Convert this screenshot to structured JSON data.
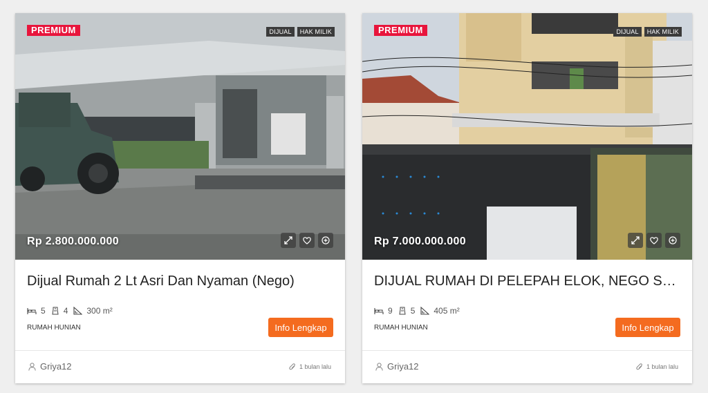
{
  "listings": [
    {
      "badge": "PREMIUM",
      "tags": [
        "DIJUAL",
        "HAK MILIK"
      ],
      "price": "Rp 2.800.000.000",
      "title": "Dijual Rumah 2 Lt Asri Dan Nyaman (Nego)",
      "bedrooms": "5",
      "bathrooms": "4",
      "area": "300 m²",
      "property_type": "RUMAH HUNIAN",
      "cta": "Info Lengkap",
      "agent": "Griya12",
      "posted": "1 bulan lalu"
    },
    {
      "badge": "PREMIUM",
      "tags": [
        "DIJUAL",
        "HAK MILIK"
      ],
      "price": "Rp 7.000.000.000",
      "title": "DIJUAL RUMAH DI PELEPAH ELOK, NEGO SAMPAI JADI",
      "bedrooms": "9",
      "bathrooms": "5",
      "area": "405 m²",
      "property_type": "RUMAH HUNIAN",
      "cta": "Info Lengkap",
      "agent": "Griya12",
      "posted": "1 bulan lalu"
    }
  ],
  "colors": {
    "premium": "#e8153c",
    "cta": "#f46b1f",
    "tag": "#3b3b3b"
  },
  "icons": [
    "expand-icon",
    "heart-icon",
    "plus-circle-icon",
    "bed-icon",
    "bath-icon",
    "area-icon",
    "user-icon",
    "paperclip-icon"
  ]
}
